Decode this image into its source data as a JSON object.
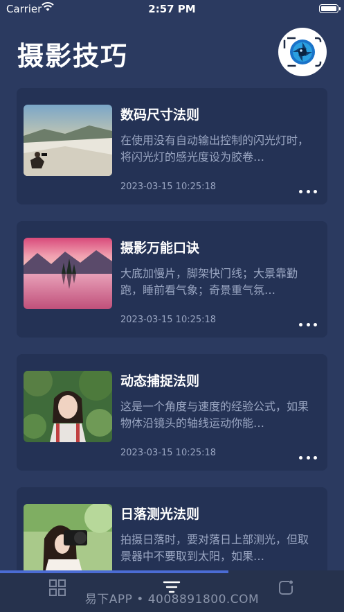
{
  "status": {
    "carrier": "Carrier",
    "time": "2:57 PM"
  },
  "header": {
    "title": "摄影技巧",
    "avatar_icon": "camera-lens-icon"
  },
  "articles": [
    {
      "title": "数码尺寸法则",
      "desc": "在使用没有自动输出控制的闪光灯时，将闪光灯的感光度设为胶卷…",
      "date": "2023-03-15 10:25:18",
      "image": "photographer-in-snow"
    },
    {
      "title": "摄影万能口诀",
      "desc": "大底加慢片，脚架快门线；大景靠勤跑，睡前看气象；奇景重气氛…",
      "date": "2023-03-15 10:25:18",
      "image": "lake-sunset"
    },
    {
      "title": "动态捕捉法则",
      "desc": "这是一个角度与速度的经验公式，如果物体沿镜头的轴线运动你能…",
      "date": "2023-03-15 10:25:18",
      "image": "girl-under-tree"
    },
    {
      "title": "日落测光法则",
      "desc": "拍摄日落时，要对落日上部测光，但取景器中不要取到太阳，如果…",
      "date": "",
      "image": "girl-with-camera"
    }
  ],
  "tabbar": {
    "tabs": [
      {
        "icon": "grid-icon"
      },
      {
        "icon": "filter-icon"
      },
      {
        "icon": "refresh-icon"
      }
    ],
    "watermark": "易下APP • 4008891800.COM"
  },
  "colors": {
    "background": "#2b3a60",
    "card": "#243255",
    "muted_text": "#9aa6c2",
    "accent": "#4b6cd4"
  }
}
